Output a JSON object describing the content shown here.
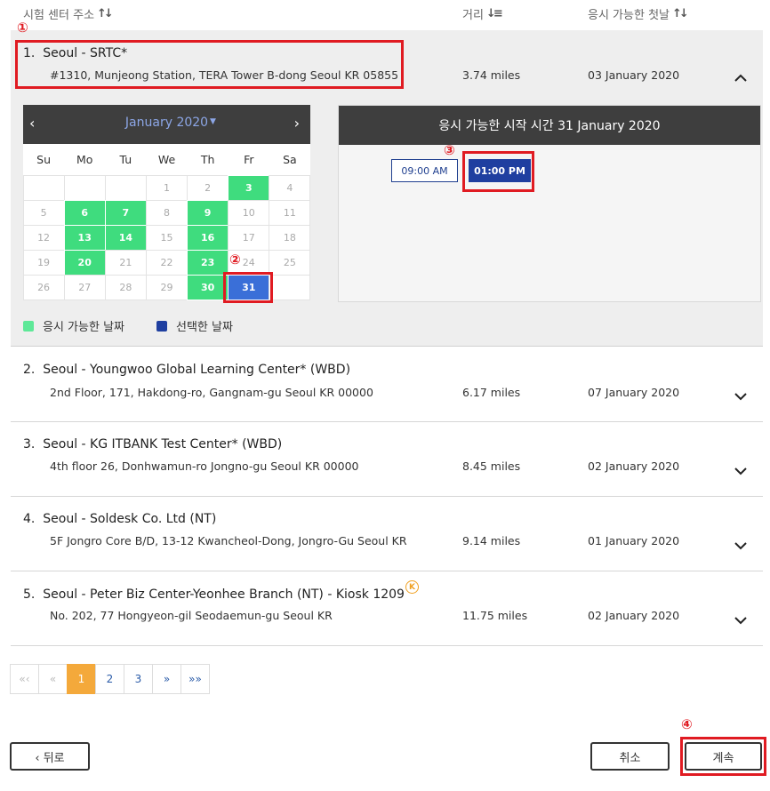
{
  "headers": {
    "address": "시험 센터 주소",
    "distance": "거리",
    "first_available": "응시 가능한 첫날"
  },
  "centers": [
    {
      "num": "1.",
      "name": "Seoul - SRTC*",
      "address": "#1310, Munjeong Station, TERA Tower B-dong Seoul KR 05855",
      "distance": "3.74 miles",
      "first_date": "03 January 2020",
      "expanded": true
    },
    {
      "num": "2.",
      "name": "Seoul - Youngwoo Global Learning Center* (WBD)",
      "address": "2nd Floor, 171, Hakdong-ro, Gangnam-gu Seoul KR 00000",
      "distance": "6.17 miles",
      "first_date": "07 January 2020"
    },
    {
      "num": "3.",
      "name": "Seoul - KG ITBANK Test Center* (WBD)",
      "address": "4th floor 26, Donhwamun-ro Jongno-gu Seoul KR 00000",
      "distance": "8.45 miles",
      "first_date": "02 January 2020"
    },
    {
      "num": "4.",
      "name": "Seoul - Soldesk Co. Ltd (NT)",
      "address": "5F Jongro Core B/D, 13-12 Kwancheol-Dong, Jongro-Gu Seoul KR",
      "distance": "9.14 miles",
      "first_date": "01 January 2020"
    },
    {
      "num": "5.",
      "name": "Seoul - Peter Biz Center-Yeonhee Branch (NT) - Kiosk 1209",
      "address": "No. 202, 77 Hongyeon-gil Seodaemun-gu Seoul KR",
      "distance": "11.75 miles",
      "first_date": "02 January 2020",
      "badge": "K"
    }
  ],
  "calendar": {
    "month": "January 2020",
    "prev": "‹",
    "next": "›",
    "caret": "▼",
    "dow": [
      "Su",
      "Mo",
      "Tu",
      "We",
      "Th",
      "Fr",
      "Sa"
    ],
    "weeks": [
      [
        null,
        null,
        null,
        1,
        2,
        3,
        4
      ],
      [
        5,
        6,
        7,
        8,
        9,
        10,
        11
      ],
      [
        12,
        13,
        14,
        15,
        16,
        17,
        18
      ],
      [
        19,
        20,
        21,
        22,
        23,
        24,
        25
      ],
      [
        26,
        27,
        28,
        29,
        30,
        31,
        null
      ]
    ],
    "available": [
      3,
      6,
      7,
      9,
      13,
      14,
      16,
      20,
      23,
      30
    ],
    "selected": 31
  },
  "legend": {
    "available": "응시 가능한 날짜",
    "selected": "선택한 날짜"
  },
  "times": {
    "title": "응시 가능한 시작 시간 31 January 2020",
    "slots": [
      "09:00 AM",
      "01:00 PM"
    ]
  },
  "steps": [
    "①",
    "②",
    "③",
    "④"
  ],
  "pagination": [
    "«‹",
    "«",
    "1",
    "2",
    "3",
    "»",
    "»»"
  ],
  "buttons": {
    "back": "‹ 뒤로",
    "cancel": "취소",
    "continue": "계속"
  },
  "colors": {
    "available": "#3fdc7e",
    "selected": "#1f3fa0",
    "highlight": "#e01b22",
    "active_page": "#f4a93b"
  }
}
